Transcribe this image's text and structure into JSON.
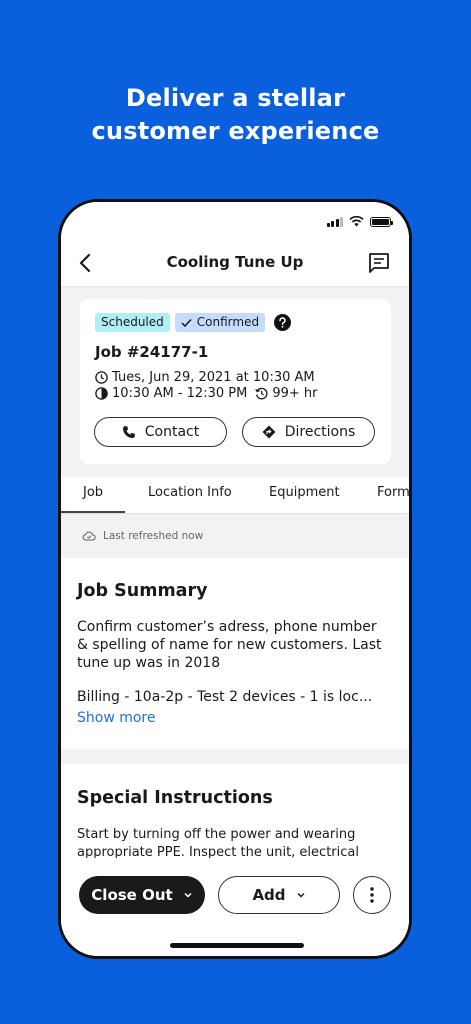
{
  "promo": {
    "headline_line1": "Deliver a stellar",
    "headline_line2": "customer experience"
  },
  "nav": {
    "title": "Cooling Tune Up"
  },
  "job": {
    "badge_scheduled": "Scheduled",
    "badge_confirmed": "Confirmed",
    "number": "Job #24177-1",
    "date_time": "Tues, Jun 29, 2021 at 10:30 AM",
    "time_window": "10:30 AM - 12:30 PM",
    "duration": "99+ hr",
    "contact_label": "Contact",
    "directions_label": "Directions"
  },
  "tabs": [
    {
      "label": "Job",
      "active": true
    },
    {
      "label": "Location Info"
    },
    {
      "label": "Equipment"
    },
    {
      "label": "Form"
    }
  ],
  "refresh": {
    "text": "Last refreshed now"
  },
  "summary": {
    "title": "Job Summary",
    "body": "Confirm customer’s adress, phone number & spelling of name for new customers. Last tune up was in 2018",
    "billing": "Billing - 10a-2p - Test 2 devices - 1 is loc...",
    "show_more": "Show more"
  },
  "instructions": {
    "title": "Special Instructions",
    "body": "Start by turning off the power and wearing appropriate PPE. Inspect the unit, electrical"
  },
  "actions": {
    "close_out": "Close Out",
    "add": "Add"
  },
  "colors": {
    "background": "#0a5fdc",
    "scheduled_badge": "#aeeef5",
    "confirmed_badge": "#c3dcff",
    "link": "#1f6fe0"
  }
}
